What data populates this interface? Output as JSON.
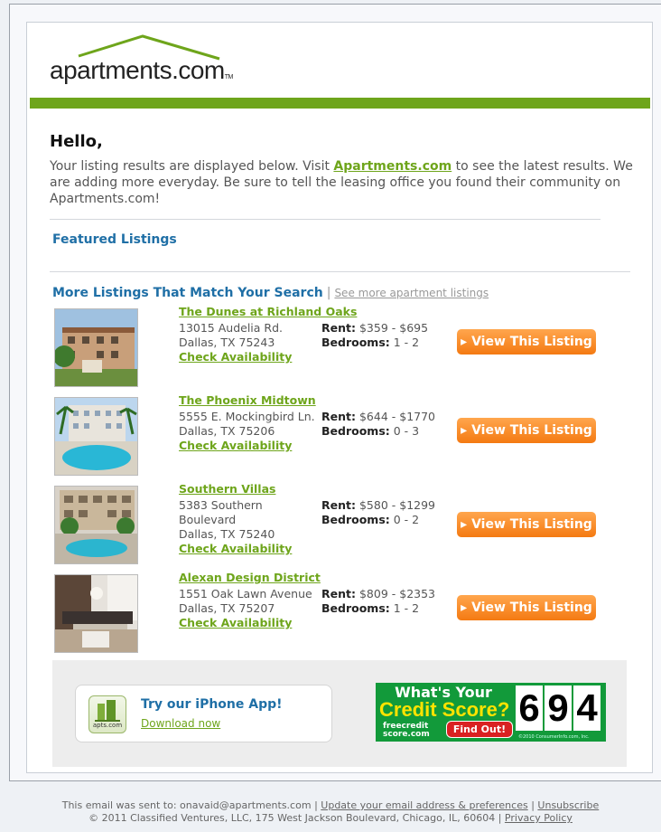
{
  "brand": {
    "logo_text": "apartments.com",
    "logo_tm": "TM",
    "accent": "#6ea51b",
    "link_blue": "#1f6fa6"
  },
  "greeting": "Hello,",
  "intro": {
    "before_link": "Your listing results are displayed below. Visit ",
    "link": "Apartments.com",
    "after_link": " to see the latest results. We are adding more everyday. Be sure to tell the leasing office you found their community on Apartments.com!"
  },
  "featured_heading": "Featured Listings",
  "more_heading": "More Listings That Match Your Search",
  "separator": "|",
  "see_more": "See more apartment listings",
  "listings": [
    {
      "name": "The Dunes at Richland Oaks",
      "address_lines": [
        "13015 Audelia Rd.",
        "Dallas, TX 75243"
      ],
      "check": "Check Availability",
      "rent_label": "Rent:",
      "rent": "$359 - $695",
      "bed_label": "Bedrooms:",
      "bedrooms": "1 - 2",
      "button": "View This Listing"
    },
    {
      "name": "The Phoenix Midtown",
      "address_lines": [
        "5555 E. Mockingbird Ln.",
        "Dallas, TX 75206"
      ],
      "check": "Check Availability",
      "rent_label": "Rent:",
      "rent": "$644 - $1770",
      "bed_label": "Bedrooms:",
      "bedrooms": "0 - 3",
      "button": "View This Listing"
    },
    {
      "name": "Southern Villas",
      "address_lines": [
        "5383 Southern",
        "Boulevard",
        "Dallas, TX 75240"
      ],
      "check": "Check Availability",
      "rent_label": "Rent:",
      "rent": "$580 - $1299",
      "bed_label": "Bedrooms:",
      "bedrooms": "0 - 2",
      "button": "View This Listing"
    },
    {
      "name": "Alexan Design District",
      "address_lines": [
        "1551 Oak Lawn Avenue",
        "Dallas, TX 75207"
      ],
      "check": "Check Availability",
      "rent_label": "Rent:",
      "rent": "$809 - $2353",
      "bed_label": "Bedrooms:",
      "bedrooms": "1 - 2",
      "button": "View This Listing"
    }
  ],
  "promo": {
    "app_title": "Try our iPhone App!",
    "app_link": "Download now",
    "app_icon_text": "apts.com",
    "ad_line1": "What's Your",
    "ad_line2": "Credit Score?",
    "ad_brand_top": "freecredit",
    "ad_brand_bottom": "score.com",
    "ad_button": "Find Out!",
    "ad_digits": [
      "6",
      "9",
      "4"
    ],
    "ad_copyright": "©2010 ConsumerInfo.com, Inc."
  },
  "footer": {
    "sent_prefix": "This email was sent to: onavaid@apartments.com",
    "update_link": "Update your email address & preferences",
    "unsubscribe": "Unsubscribe",
    "copyright": "© 2011 Classified Ventures, LLC, 175 West Jackson Boulevard, Chicago, IL, 60604",
    "privacy": "Privacy Policy",
    "sep": "|"
  }
}
